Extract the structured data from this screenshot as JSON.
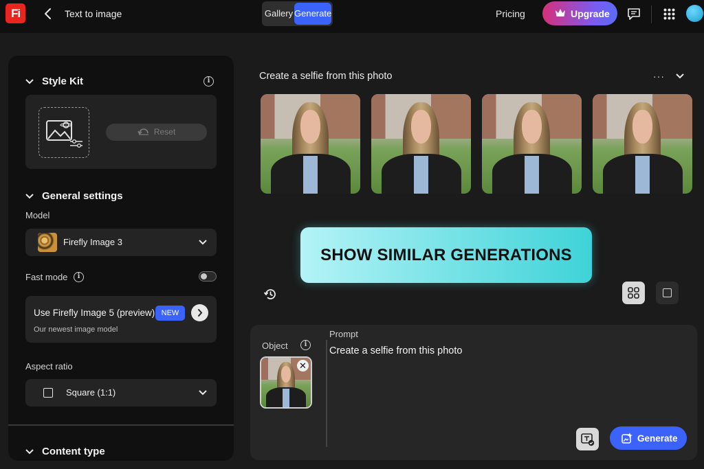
{
  "app": {
    "logo_text": "Fi",
    "page_title": "Text to image"
  },
  "topbar": {
    "tabs": [
      {
        "label": "Gallery"
      },
      {
        "label": "Generate",
        "active": true
      }
    ],
    "pricing_label": "Pricing",
    "upgrade_label": "Upgrade",
    "upgrade_gradient": [
      "#d6307a",
      "#5a6bf8"
    ]
  },
  "left_panel": {
    "style_kit": {
      "heading": "Style Kit",
      "reset_label": "Reset"
    },
    "general_settings": {
      "heading": "General settings",
      "model_label": "Model",
      "model_value": "Firefly Image 3",
      "fast_mode_label": "Fast mode",
      "fast_mode_on": false,
      "promo_title": "Use Firefly Image 5 (preview)",
      "promo_badge": "NEW",
      "promo_subtitle": "Our newest image model",
      "aspect_ratio_label": "Aspect ratio",
      "aspect_ratio_value": "Square (1:1)"
    },
    "content_type": {
      "heading": "Content type"
    }
  },
  "main": {
    "generation_title": "Create a selfie from this photo",
    "more_label": "···",
    "thumbnails": [
      {
        "name": "generated-image-1"
      },
      {
        "name": "generated-image-2"
      },
      {
        "name": "generated-image-3"
      },
      {
        "name": "generated-image-4"
      }
    ],
    "cta_label": "SHOW SIMILAR GENERATIONS",
    "accent_color": "#3b63fb",
    "cta_colors": [
      "#b4f3f6",
      "#3ed3d8"
    ]
  },
  "prompt_panel": {
    "object_label": "Object",
    "prompt_label": "Prompt",
    "prompt_text": "Create a selfie from this photo",
    "remove_label": "✕",
    "generate_label": "Generate"
  }
}
